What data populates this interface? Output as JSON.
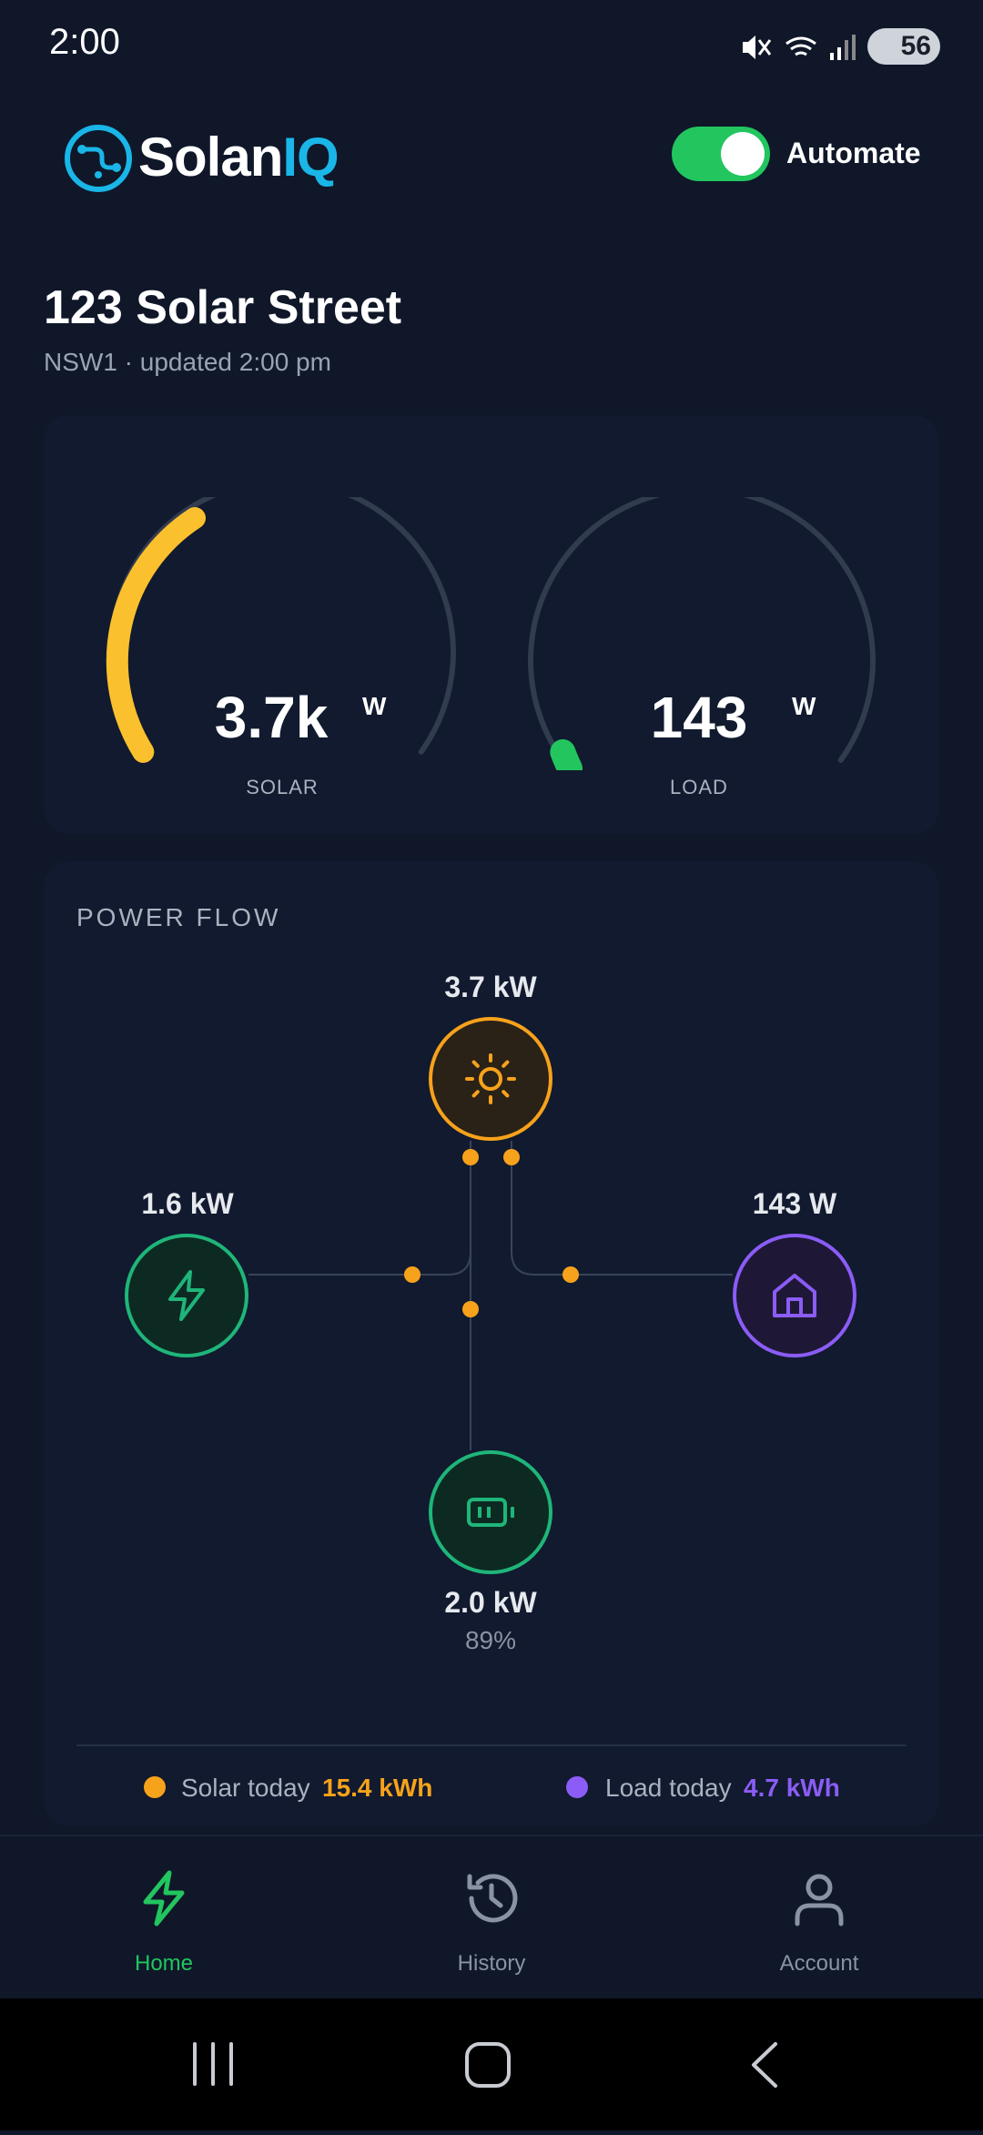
{
  "status_bar": {
    "time": "2:00",
    "battery": "56",
    "icons": [
      "mute-icon",
      "wifi-icon",
      "signal-icon",
      "battery-icon"
    ]
  },
  "header": {
    "logo_text_main": "Solan",
    "logo_text_accent": "IQ",
    "automate_label": "Automate",
    "automate_on": true
  },
  "site": {
    "address": "123 Solar Street",
    "subtitle": "NSW1 · updated 2:00 pm"
  },
  "gauges": {
    "solar": {
      "value": "3.7k",
      "unit": "W",
      "label": "SOLAR",
      "color": "#fbc02d"
    },
    "load": {
      "value": "143",
      "unit": "W",
      "label": "LOAD",
      "color": "#22c55e"
    }
  },
  "power_flow": {
    "title": "POWER FLOW",
    "solar": {
      "value": "3.7 kW",
      "color": "#f7a21b"
    },
    "grid": {
      "value": "1.6 kW",
      "color": "#1fb57a"
    },
    "home": {
      "value": "143 W",
      "color": "#8b5cf6"
    },
    "battery": {
      "value": "2.0 kW",
      "percent": "89%",
      "color": "#1fb57a"
    }
  },
  "summary": {
    "solar_label": "Solar today",
    "solar_value": "15.4 kWh",
    "solar_color": "#f7a21b",
    "load_label": "Load today",
    "load_value": "4.7 kWh",
    "load_color": "#8b5cf6"
  },
  "nav": {
    "home": "Home",
    "history": "History",
    "account": "Account",
    "active_color": "#22c55e",
    "inactive_color": "#8a93a3"
  }
}
